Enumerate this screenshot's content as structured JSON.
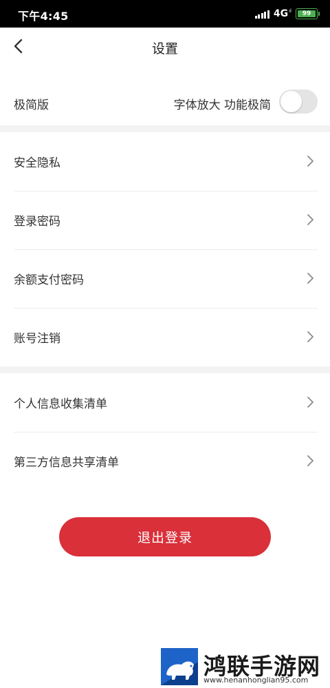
{
  "status_bar": {
    "time": "下午4:45",
    "network": "4G",
    "network_sup": "ıl",
    "battery_level": "99",
    "battery_fraction": 0.99,
    "battery_color": "#4caf50"
  },
  "header": {
    "back_icon": "chevron-left-icon",
    "title": "设置"
  },
  "mode": {
    "label": "极简版",
    "description": "字体放大 功能极简",
    "toggle_on": false
  },
  "groups": [
    {
      "items": [
        {
          "label": "安全隐私",
          "icon": "chevron-right-icon"
        },
        {
          "label": "登录密码",
          "icon": "chevron-right-icon"
        },
        {
          "label": "余额支付密码",
          "icon": "chevron-right-icon"
        },
        {
          "label": "账号注销",
          "icon": "chevron-right-icon"
        }
      ]
    },
    {
      "items": [
        {
          "label": "个人信息收集清单",
          "icon": "chevron-right-icon"
        },
        {
          "label": "第三方信息共享清单",
          "icon": "chevron-right-icon"
        }
      ]
    }
  ],
  "logout": {
    "label": "退出登录",
    "color": "#d9303a"
  },
  "watermark": {
    "title": "鸿联手游网",
    "url": "www.henanhonglian95.com",
    "logo_icon": "bison-logo-icon"
  }
}
